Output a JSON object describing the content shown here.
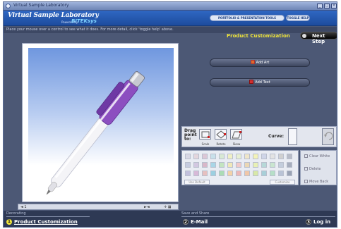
{
  "window": {
    "title": "Virtual Sample Laboratory"
  },
  "header": {
    "app_title": "Virtual Sample Laboratory",
    "powered_by": "Powered by",
    "brand": "BITEKsys",
    "links": [
      "PORTFOLIO & PRESENTATION TOOLS",
      "TOGGLE HELP"
    ]
  },
  "infobar": {
    "text": "Place your mouse over a control to see what it does. For more detail, click 'toggle help' above."
  },
  "panel": {
    "title": "Product Customization",
    "next_step": "Next Step",
    "add_art": "Add Art",
    "add_text": "Add Text"
  },
  "tools": {
    "drag_label": "Drag point to:",
    "scale": "Scale",
    "rotate": "Rotate",
    "skew": "Skew",
    "curve": "Curve:",
    "undo": "Undo"
  },
  "palette": {
    "default_btn": "Use Default",
    "custom_btn": "Customize",
    "colors": [
      "#d7d7e4",
      "#e4d6dd",
      "#dcc7d6",
      "#c8e0ea",
      "#d8e9d4",
      "#f0f0c5",
      "#e7efd4",
      "#efe6c9",
      "#f3f3b8",
      "#cfd5e8",
      "#e3e3e3",
      "#d0d0d0",
      "#b8bcc8",
      "#c5cbe0",
      "#d2c7e0",
      "#d8b7c9",
      "#a9d5e6",
      "#c3e4c0",
      "#f0e8b8",
      "#f0c9c9",
      "#ead7b4",
      "#e8f0b5",
      "#b6d8d8",
      "#c9e5cf",
      "#c3cddc",
      "#a6adbd",
      "#c2c0dd",
      "#d7b9d7",
      "#e6c0c0",
      "#9ccfe0",
      "#abdcb5",
      "#f3d2a8",
      "#ecb7b7",
      "#f0c7a8",
      "#d8e8a8",
      "#a8cfd8",
      "#b6dfc7",
      "#b9c3d6",
      "#9aa3b5"
    ],
    "side": {
      "clear": "Clear White",
      "delete": "Delete",
      "move_back": "Move Back"
    }
  },
  "canvas_toolbar": {
    "left": "◄ 1",
    "right": "►◄ ",
    "grid": "✛ ▦"
  },
  "footer": {
    "section_left": "Decorating",
    "section_right": "Save and Share",
    "steps": [
      {
        "num": "1",
        "label": "Product Customization"
      },
      {
        "num": "2",
        "label": "E-Mail"
      },
      {
        "num": "3",
        "label": "Log in"
      }
    ]
  },
  "colors": {
    "accent_yellow": "#f0e53a",
    "header_blue": "#2f67c2",
    "body_bg": "#4c5875",
    "pen_purple": "#8c4fc0"
  }
}
